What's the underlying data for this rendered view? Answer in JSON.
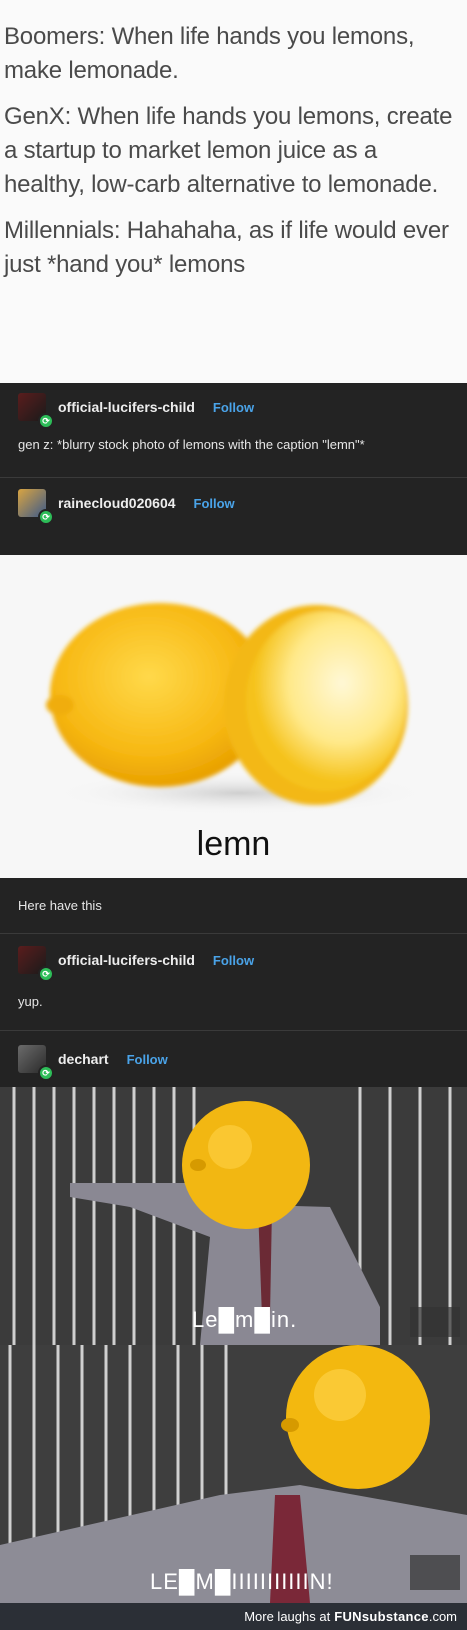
{
  "top": {
    "lines": [
      "Boomers: When life hands you lemons, make lemonade.",
      "GenX: When life hands you lemons, create a startup to market lemon juice as a healthy, low-carb alternative to lemonade.",
      "Millennials: Hahahaha, as if life would ever just *hand you* lemons"
    ]
  },
  "posts": [
    {
      "username": "official-lucifers-child",
      "follow": "Follow",
      "text": "gen z: *blurry stock photo of lemons with the caption \"lemn\"*"
    },
    {
      "username": "rainecloud020604",
      "follow": "Follow"
    },
    {
      "text": "Here have this"
    },
    {
      "username": "official-lucifers-child",
      "follow": "Follow",
      "text": "yup."
    },
    {
      "username": "dechart",
      "follow": "Follow"
    }
  ],
  "lemon_image": {
    "caption": "lemn"
  },
  "meme": {
    "panel1_caption": "Le█m█in.",
    "panel2_caption": "LE█M█IIIIIIIIIIIN!"
  },
  "footer": {
    "text": "More laughs at",
    "brand": "FUNsubstance",
    "suffix": ".com"
  },
  "colors": {
    "follow": "#4aa3e8",
    "badge": "#2dbd58",
    "dark_bg": "#232323"
  }
}
